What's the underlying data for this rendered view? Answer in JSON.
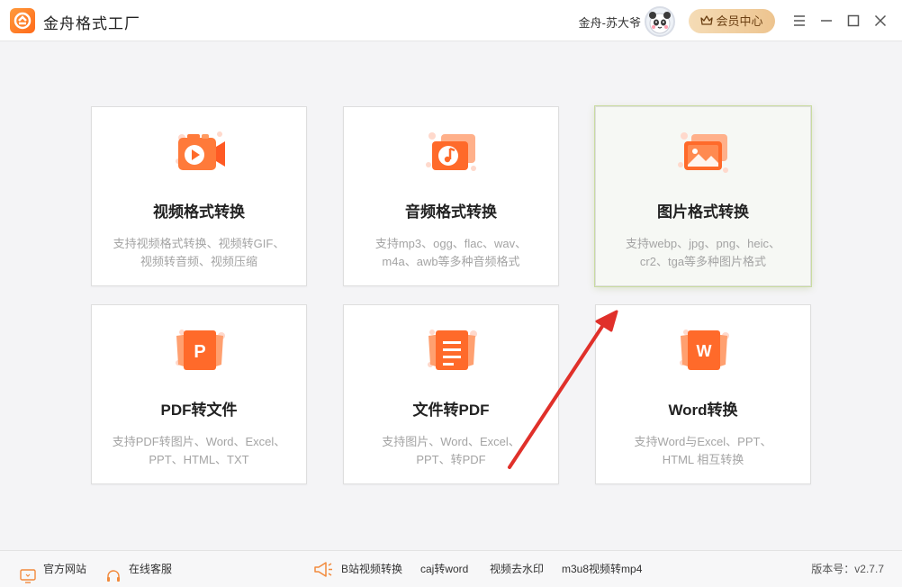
{
  "app": {
    "title": "金舟格式工厂",
    "username": "金舟-苏大爷",
    "vip_label": "会员中心",
    "accent": "#ff6a1a",
    "vip_color": "#edc48f"
  },
  "cards": [
    {
      "title": "视频格式转换",
      "desc_line1": "支持视频格式转换、视频转GIF、",
      "desc_line2": "视频转音频、视频压缩",
      "icon": "video-play-icon"
    },
    {
      "title": "音频格式转换",
      "desc_line1": "支持mp3、ogg、flac、wav、",
      "desc_line2": "m4a、awb等多种音频格式",
      "icon": "music-note-icon"
    },
    {
      "title": "图片格式转换",
      "desc_line1": "支持webp、jpg、png、heic、",
      "desc_line2": "cr2、tga等多种图片格式",
      "icon": "image-icon",
      "active": true
    },
    {
      "title": "PDF转文件",
      "desc_line1": "支持PDF转图片、Word、Excel、",
      "desc_line2": "PPT、HTML、TXT",
      "icon": "pdf-p-icon"
    },
    {
      "title": "文件转PDF",
      "desc_line1": "支持图片、Word、Excel、",
      "desc_line2": "PPT、转PDF",
      "icon": "document-lines-icon"
    },
    {
      "title": "Word转换",
      "desc_line1": "支持Word与Excel、PPT、",
      "desc_line2": "HTML 相互转换",
      "icon": "word-w-icon"
    }
  ],
  "footer": {
    "website": "官方网站",
    "support": "在线客服",
    "links": [
      "B站视频转换",
      "caj转word",
      "视频去水印",
      "m3u8视频转mp4"
    ],
    "version": "版本号：v2.7.7"
  },
  "annotation": {
    "color": "#e0302a"
  }
}
